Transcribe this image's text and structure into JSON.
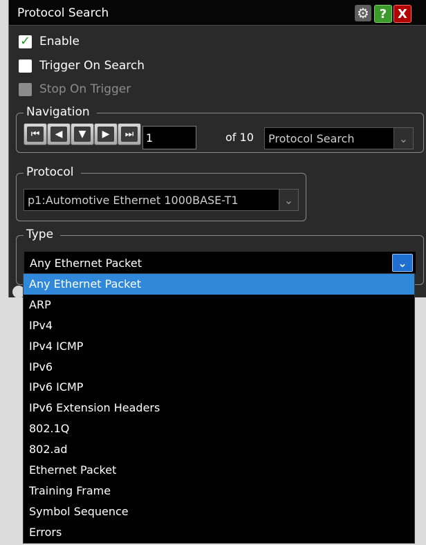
{
  "window": {
    "title": "Protocol Search",
    "icons": {
      "gear": "gear-icon",
      "help": "?",
      "close": "X"
    }
  },
  "checkboxes": [
    {
      "label": "Enable",
      "checked": true,
      "enabled": true
    },
    {
      "label": "Trigger On Search",
      "checked": false,
      "enabled": true
    },
    {
      "label": "Stop On Trigger",
      "checked": false,
      "enabled": false
    }
  ],
  "navigation": {
    "legend": "Navigation",
    "buttons": [
      "first",
      "previous",
      "down",
      "next",
      "last"
    ],
    "current": "1",
    "of_label": "of",
    "total": "10",
    "selected": "Protocol Search"
  },
  "protocol": {
    "legend": "Protocol",
    "selected": "p1:Automotive Ethernet 1000BASE-T1"
  },
  "type": {
    "legend": "Type",
    "selected": "Any Ethernet Packet",
    "options": [
      "Any Ethernet Packet",
      "ARP",
      "IPv4",
      "IPv4 ICMP",
      "IPv6",
      "IPv6 ICMP",
      "IPv6 Extension Headers",
      "802.1Q",
      "802.ad",
      "Ethernet Packet",
      "Training Frame",
      "Symbol Sequence",
      "Errors"
    ],
    "highlighted_index": 0
  },
  "colors": {
    "highlight": "#2f88d9",
    "check": "#1f9a1f",
    "help": "#3a9a2a",
    "close": "#b00000"
  }
}
